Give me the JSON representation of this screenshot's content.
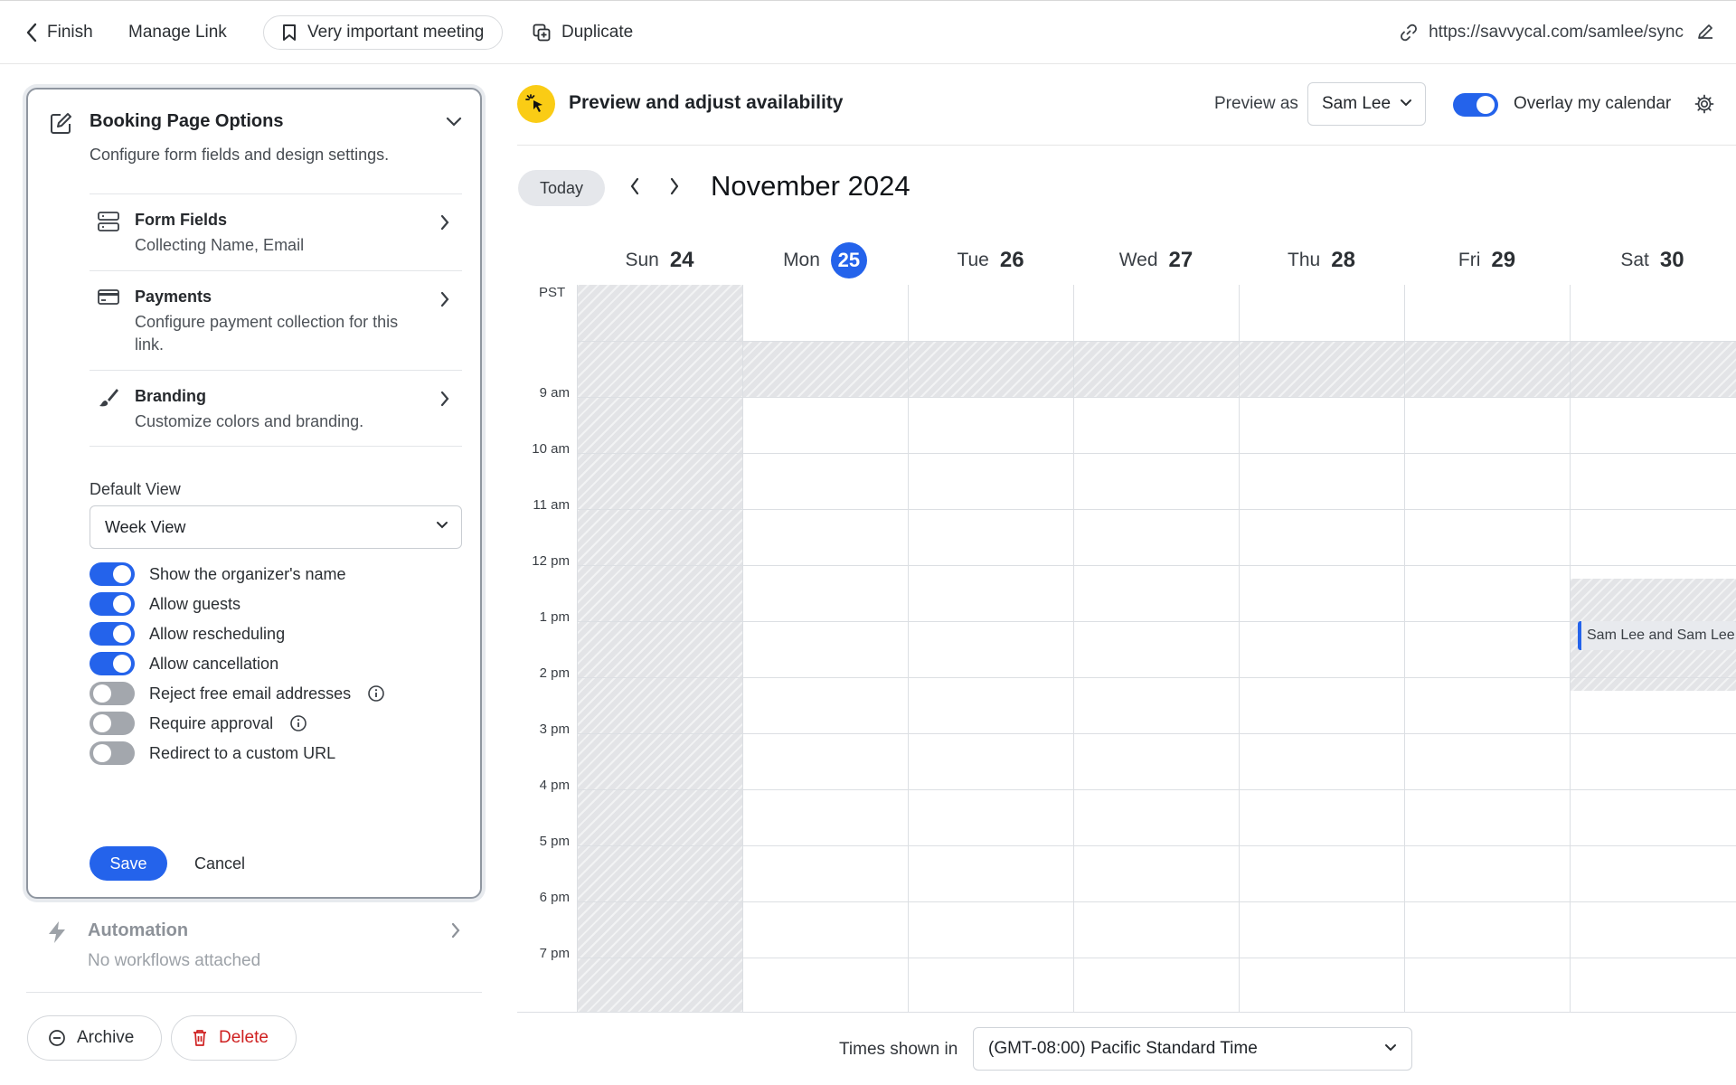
{
  "topbar": {
    "finish_label": "Finish",
    "manage_link_label": "Manage Link",
    "meeting_title": "Very important meeting",
    "duplicate_label": "Duplicate",
    "link_url": "https://savvycal.com/samlee/sync"
  },
  "booking_options": {
    "title": "Booking Page Options",
    "subtitle": "Configure form fields and design settings.",
    "items": [
      {
        "title": "Form Fields",
        "description": "Collecting Name, Email",
        "icon": "form-fields-icon"
      },
      {
        "title": "Payments",
        "description": "Configure payment collection for this link.",
        "icon": "credit-card-icon"
      },
      {
        "title": "Branding",
        "description": "Customize colors and branding.",
        "icon": "paintbrush-icon"
      }
    ],
    "default_view_label": "Default View",
    "default_view_value": "Week View",
    "toggles": [
      {
        "label": "Show the organizer's name",
        "on": true,
        "info": false
      },
      {
        "label": "Allow guests",
        "on": true,
        "info": false
      },
      {
        "label": "Allow rescheduling",
        "on": true,
        "info": false
      },
      {
        "label": "Allow cancellation",
        "on": true,
        "info": false
      },
      {
        "label": "Reject free email addresses",
        "on": false,
        "info": true
      },
      {
        "label": "Require approval",
        "on": false,
        "info": true
      },
      {
        "label": "Redirect to a custom URL",
        "on": false,
        "info": false
      }
    ],
    "save_label": "Save",
    "cancel_label": "Cancel"
  },
  "automation": {
    "title": "Automation",
    "subtitle": "No workflows attached"
  },
  "footer_buttons": {
    "archive_label": "Archive",
    "delete_label": "Delete"
  },
  "preview": {
    "title": "Preview and adjust availability",
    "preview_as_label": "Preview as",
    "preview_as_value": "Sam Lee",
    "overlay_label": "Overlay my calendar",
    "overlay_on": true
  },
  "calendar": {
    "today_label": "Today",
    "month_label": "November 2024",
    "timezone_abbr": "PST",
    "days": [
      {
        "name": "Sun",
        "num": "24",
        "today": false
      },
      {
        "name": "Mon",
        "num": "25",
        "today": true
      },
      {
        "name": "Tue",
        "num": "26",
        "today": false
      },
      {
        "name": "Wed",
        "num": "27",
        "today": false
      },
      {
        "name": "Thu",
        "num": "28",
        "today": false
      },
      {
        "name": "Fri",
        "num": "29",
        "today": false
      },
      {
        "name": "Sat",
        "num": "30",
        "today": false
      }
    ],
    "time_labels": [
      "9 am",
      "10 am",
      "11 am",
      "12 pm",
      "1 pm",
      "2 pm",
      "3 pm",
      "4 pm",
      "5 pm",
      "6 pm",
      "7 pm"
    ],
    "event_label": "Sam Lee and Sam Lee,",
    "times_shown_label": "Times shown in",
    "timezone_value": "(GMT-08:00) Pacific Standard Time"
  },
  "colors": {
    "accent": "#2463eb",
    "delete": "#cf2020",
    "preview_badge": "#facc15",
    "unavailable": "#e3e4e7"
  }
}
